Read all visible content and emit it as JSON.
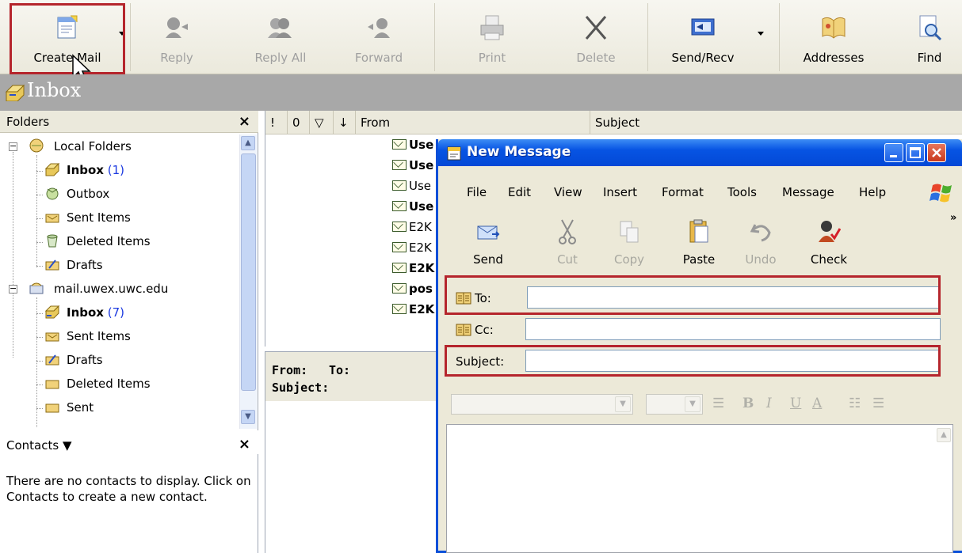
{
  "toolbar": {
    "buttons": [
      {
        "label": "Create Mail",
        "icon": "create-mail-icon",
        "enabled": true
      },
      {
        "label": "Reply",
        "icon": "reply-icon",
        "enabled": false
      },
      {
        "label": "Reply All",
        "icon": "reply-all-icon",
        "enabled": false
      },
      {
        "label": "Forward",
        "icon": "forward-icon",
        "enabled": false
      },
      {
        "label": "Print",
        "icon": "printer-icon",
        "enabled": false
      },
      {
        "label": "Delete",
        "icon": "delete-x-icon",
        "enabled": false
      },
      {
        "label": "Send/Recv",
        "icon": "send-receive-icon",
        "enabled": true
      },
      {
        "label": "Addresses",
        "icon": "address-book-icon",
        "enabled": true
      },
      {
        "label": "Find",
        "icon": "find-icon",
        "enabled": true
      }
    ]
  },
  "banner": {
    "title": "Inbox"
  },
  "folders": {
    "header": "Folders",
    "close": "×",
    "tree": [
      {
        "label": "Local Folders",
        "bold": false,
        "count": ""
      },
      {
        "label": "Inbox",
        "bold": true,
        "count": "(1)"
      },
      {
        "label": "Outbox",
        "bold": false,
        "count": ""
      },
      {
        "label": "Sent Items",
        "bold": false,
        "count": ""
      },
      {
        "label": "Deleted Items",
        "bold": false,
        "count": ""
      },
      {
        "label": "Drafts",
        "bold": false,
        "count": ""
      },
      {
        "label": "mail.uwex.uwc.edu",
        "bold": false,
        "count": ""
      },
      {
        "label": "Inbox",
        "bold": true,
        "count": "(7)"
      },
      {
        "label": "Sent Items",
        "bold": false,
        "count": ""
      },
      {
        "label": "Drafts",
        "bold": false,
        "count": ""
      },
      {
        "label": "Deleted Items",
        "bold": false,
        "count": ""
      },
      {
        "label": "Sent",
        "bold": false,
        "count": ""
      }
    ]
  },
  "contacts": {
    "header": "Contacts ▼",
    "close": "×",
    "empty_message": "There are no contacts to display. Click on Contacts to create a new contact."
  },
  "message_list": {
    "columns": [
      "!",
      "0",
      "▽",
      "↓",
      "From",
      "Subject"
    ],
    "rows": [
      {
        "from": "Use",
        "bold": true
      },
      {
        "from": "Use",
        "bold": true
      },
      {
        "from": "Use",
        "bold": false
      },
      {
        "from": "Use",
        "bold": true
      },
      {
        "from": "E2K",
        "bold": false
      },
      {
        "from": "E2K",
        "bold": false
      },
      {
        "from": "E2K",
        "bold": true
      },
      {
        "from": "pos",
        "bold": true
      },
      {
        "from": "E2K",
        "bold": true
      }
    ]
  },
  "preview": {
    "from_label": "From:",
    "to_label": "To:",
    "subject_label": "Subject:"
  },
  "new_message": {
    "title": "New Message",
    "menu": [
      "File",
      "Edit",
      "View",
      "Insert",
      "Format",
      "Tools",
      "Message",
      "Help"
    ],
    "toolbar": [
      {
        "label": "Send",
        "icon": "send-icon",
        "enabled": true
      },
      {
        "label": "Cut",
        "icon": "scissors-icon",
        "enabled": false
      },
      {
        "label": "Copy",
        "icon": "copy-icon",
        "enabled": false
      },
      {
        "label": "Paste",
        "icon": "paste-icon",
        "enabled": true
      },
      {
        "label": "Undo",
        "icon": "undo-icon",
        "enabled": false
      },
      {
        "label": "Check",
        "icon": "check-names-icon",
        "enabled": true
      }
    ],
    "fields": {
      "to_label": "To:",
      "to_value": "",
      "cc_label": "Cc:",
      "cc_value": "",
      "subject_label": "Subject:",
      "subject_value": ""
    },
    "format_buttons": [
      "B",
      "I",
      "U",
      "A"
    ]
  },
  "colors": {
    "highlight": "#b5252c",
    "xp_title_blue": "#0754e3",
    "link_count": "#1c3ae0"
  }
}
